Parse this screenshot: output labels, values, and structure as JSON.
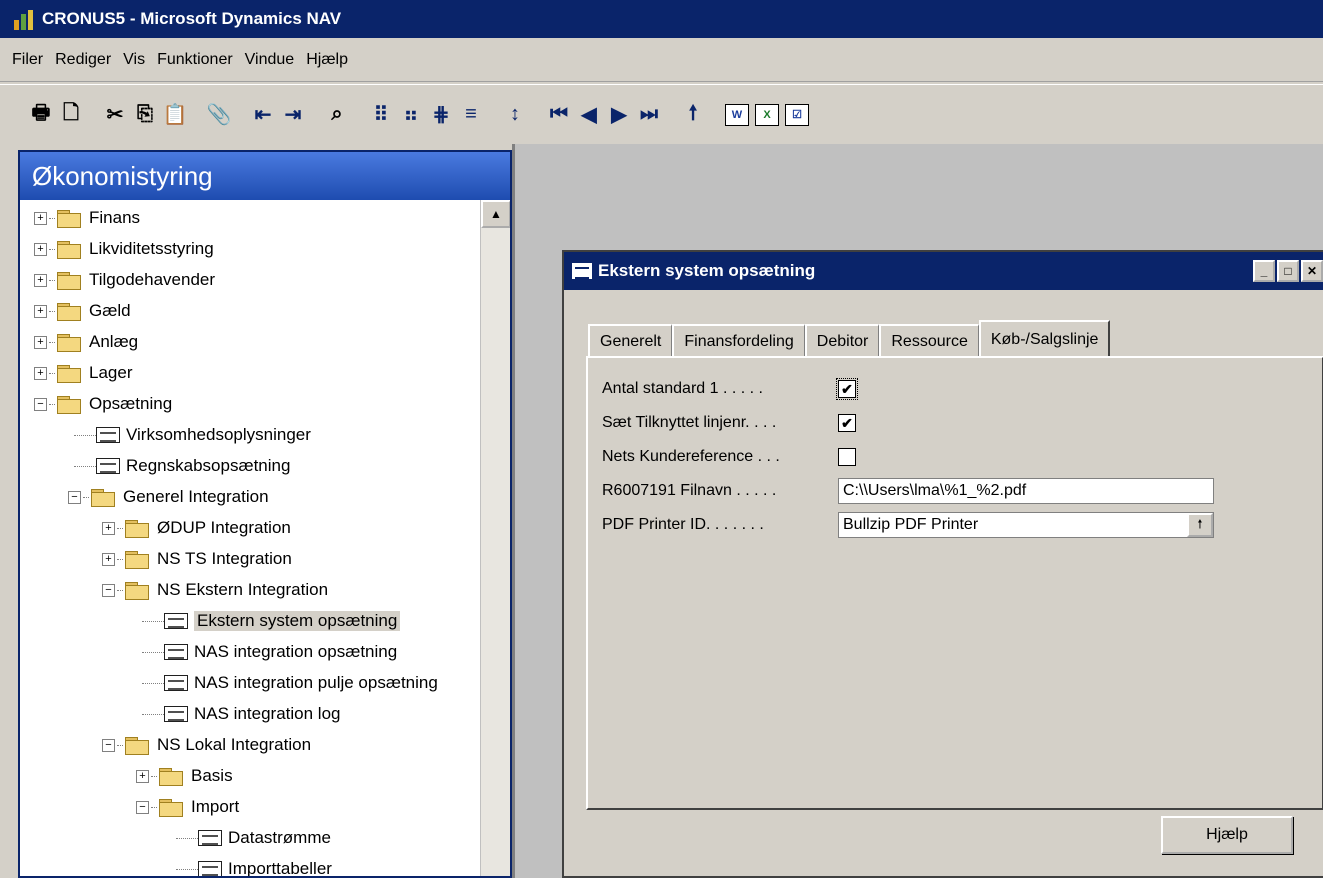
{
  "window": {
    "title": "CRONUS5 - Microsoft Dynamics NAV"
  },
  "menu": [
    "Filer",
    "Rediger",
    "Vis",
    "Funktioner",
    "Vindue",
    "Hjælp"
  ],
  "navpane": {
    "header": "Økonomistyring",
    "items": [
      {
        "label": "Finans",
        "type": "folder",
        "state": "collapsed",
        "level": 0
      },
      {
        "label": "Likviditetsstyring",
        "type": "folder",
        "state": "collapsed",
        "level": 0
      },
      {
        "label": "Tilgodehavender",
        "type": "folder",
        "state": "collapsed",
        "level": 0
      },
      {
        "label": "Gæld",
        "type": "folder",
        "state": "collapsed",
        "level": 0
      },
      {
        "label": "Anlæg",
        "type": "folder",
        "state": "collapsed",
        "level": 0
      },
      {
        "label": "Lager",
        "type": "folder",
        "state": "collapsed",
        "level": 0
      },
      {
        "label": "Opsætning",
        "type": "folder",
        "state": "expanded",
        "level": 0
      },
      {
        "label": "Virksomhedsoplysninger",
        "type": "form",
        "level": 1
      },
      {
        "label": "Regnskabsopsætning",
        "type": "form",
        "level": 1
      },
      {
        "label": "Generel Integration",
        "type": "folder",
        "state": "expanded",
        "level": 1
      },
      {
        "label": "ØDUP Integration",
        "type": "folder",
        "state": "collapsed",
        "level": 2
      },
      {
        "label": "NS TS Integration",
        "type": "folder",
        "state": "collapsed",
        "level": 2
      },
      {
        "label": "NS Ekstern Integration",
        "type": "folder",
        "state": "expanded",
        "level": 2
      },
      {
        "label": "Ekstern system opsætning",
        "type": "form",
        "level": 3,
        "selected": true
      },
      {
        "label": "NAS integration opsætning",
        "type": "form",
        "level": 3
      },
      {
        "label": "NAS integration pulje opsætning",
        "type": "form",
        "level": 3
      },
      {
        "label": "NAS integration log",
        "type": "form",
        "level": 3
      },
      {
        "label": "NS Lokal Integration",
        "type": "folder",
        "state": "expanded",
        "level": 2
      },
      {
        "label": "Basis",
        "type": "folder",
        "state": "collapsed",
        "level": 3
      },
      {
        "label": "Import",
        "type": "folder",
        "state": "expanded",
        "level": 3
      },
      {
        "label": "Datastrømme",
        "type": "form",
        "level": 4
      },
      {
        "label": "Importtabeller",
        "type": "form",
        "level": 4
      }
    ]
  },
  "dialog": {
    "title": "Ekstern system opsætning",
    "tabs": [
      "Generelt",
      "Finansfordeling",
      "Debitor",
      "Ressource",
      "Køb-/Salgslinje"
    ],
    "active_tab": "Køb-/Salgslinje",
    "fields": {
      "antal_standard": {
        "label": "Antal standard 1 . . . . .",
        "checked": true
      },
      "saet_tilknyttet": {
        "label": "Sæt Tilknyttet linjenr. . . .",
        "checked": true
      },
      "nets_kundereference": {
        "label": "Nets Kundereference . . .",
        "checked": false
      },
      "filnavn": {
        "label": "R6007191 Filnavn . . . . .",
        "value": "C:\\\\Users\\lma\\%1_%2.pdf"
      },
      "pdf_printer": {
        "label": "PDF Printer ID. . . . . . .",
        "value": "Bullzip PDF Printer"
      }
    },
    "help_label": "Hjælp"
  }
}
